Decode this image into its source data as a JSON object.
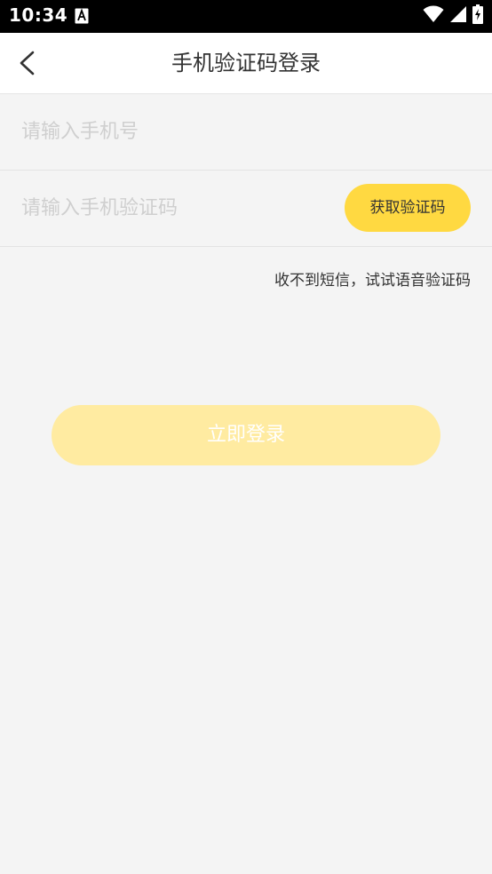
{
  "status_bar": {
    "time": "10:34",
    "icons": [
      "app-notification-icon",
      "wifi-icon",
      "signal-icon",
      "battery-charging-icon"
    ]
  },
  "header": {
    "title": "手机验证码登录",
    "back_icon": "chevron-left-icon"
  },
  "form": {
    "phone_placeholder": "请输入手机号",
    "phone_value": "",
    "code_placeholder": "请输入手机验证码",
    "code_value": "",
    "get_code_label": "获取验证码",
    "voice_code_link": "收不到短信，试试语音验证码",
    "login_label": "立即登录"
  },
  "colors": {
    "accent": "#ffd941",
    "login_disabled": "#ffeba1",
    "background": "#f4f4f4",
    "placeholder": "#cfcfcf"
  }
}
